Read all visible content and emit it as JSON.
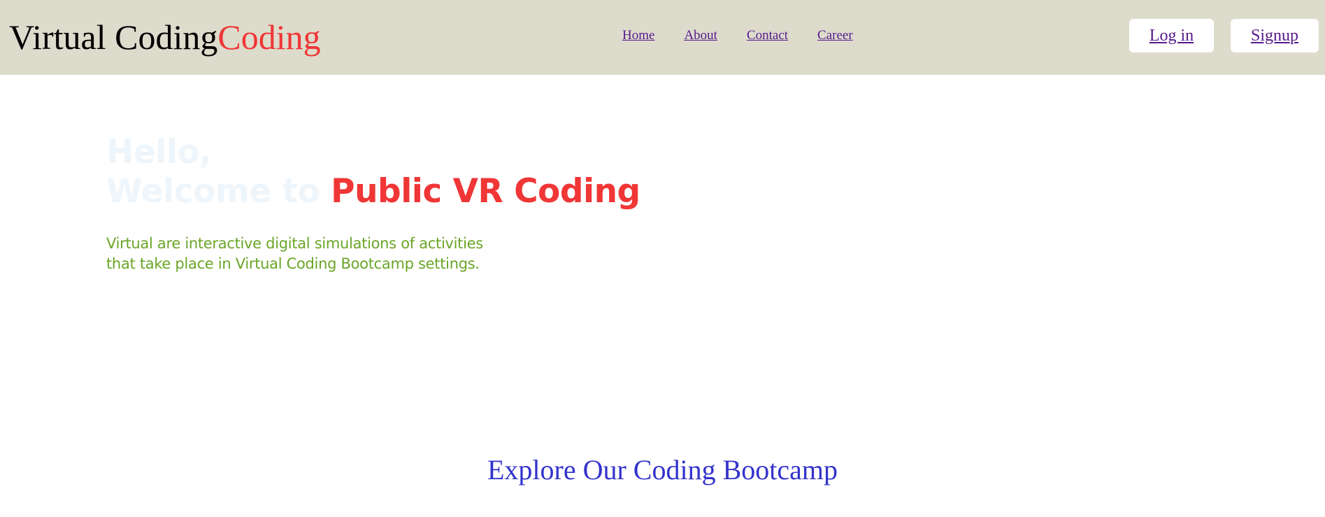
{
  "brand": {
    "part1": "Virtual Coding",
    "part2": "Coding"
  },
  "nav": {
    "links": [
      "Home",
      "About",
      "Contact",
      "Career"
    ],
    "login": "Log in",
    "signup": "Signup"
  },
  "hero": {
    "line1": "Hello,",
    "line2": "Welcome to ",
    "highlight": "Public VR Coding",
    "desc_line1": "Virtual are interactive digital simulations of activities",
    "desc_line2": "that take place in Virtual Coding Bootcamp settings."
  },
  "section": {
    "title": "Explore Our Coding Bootcamp"
  },
  "colors": {
    "navbar_bg": "#dddbcc",
    "accent_red": "#f03636",
    "link_purple": "#551a8b",
    "desc_green": "#6aa527",
    "section_blue": "#3333cc",
    "hero_faint": "#eef5fb"
  }
}
